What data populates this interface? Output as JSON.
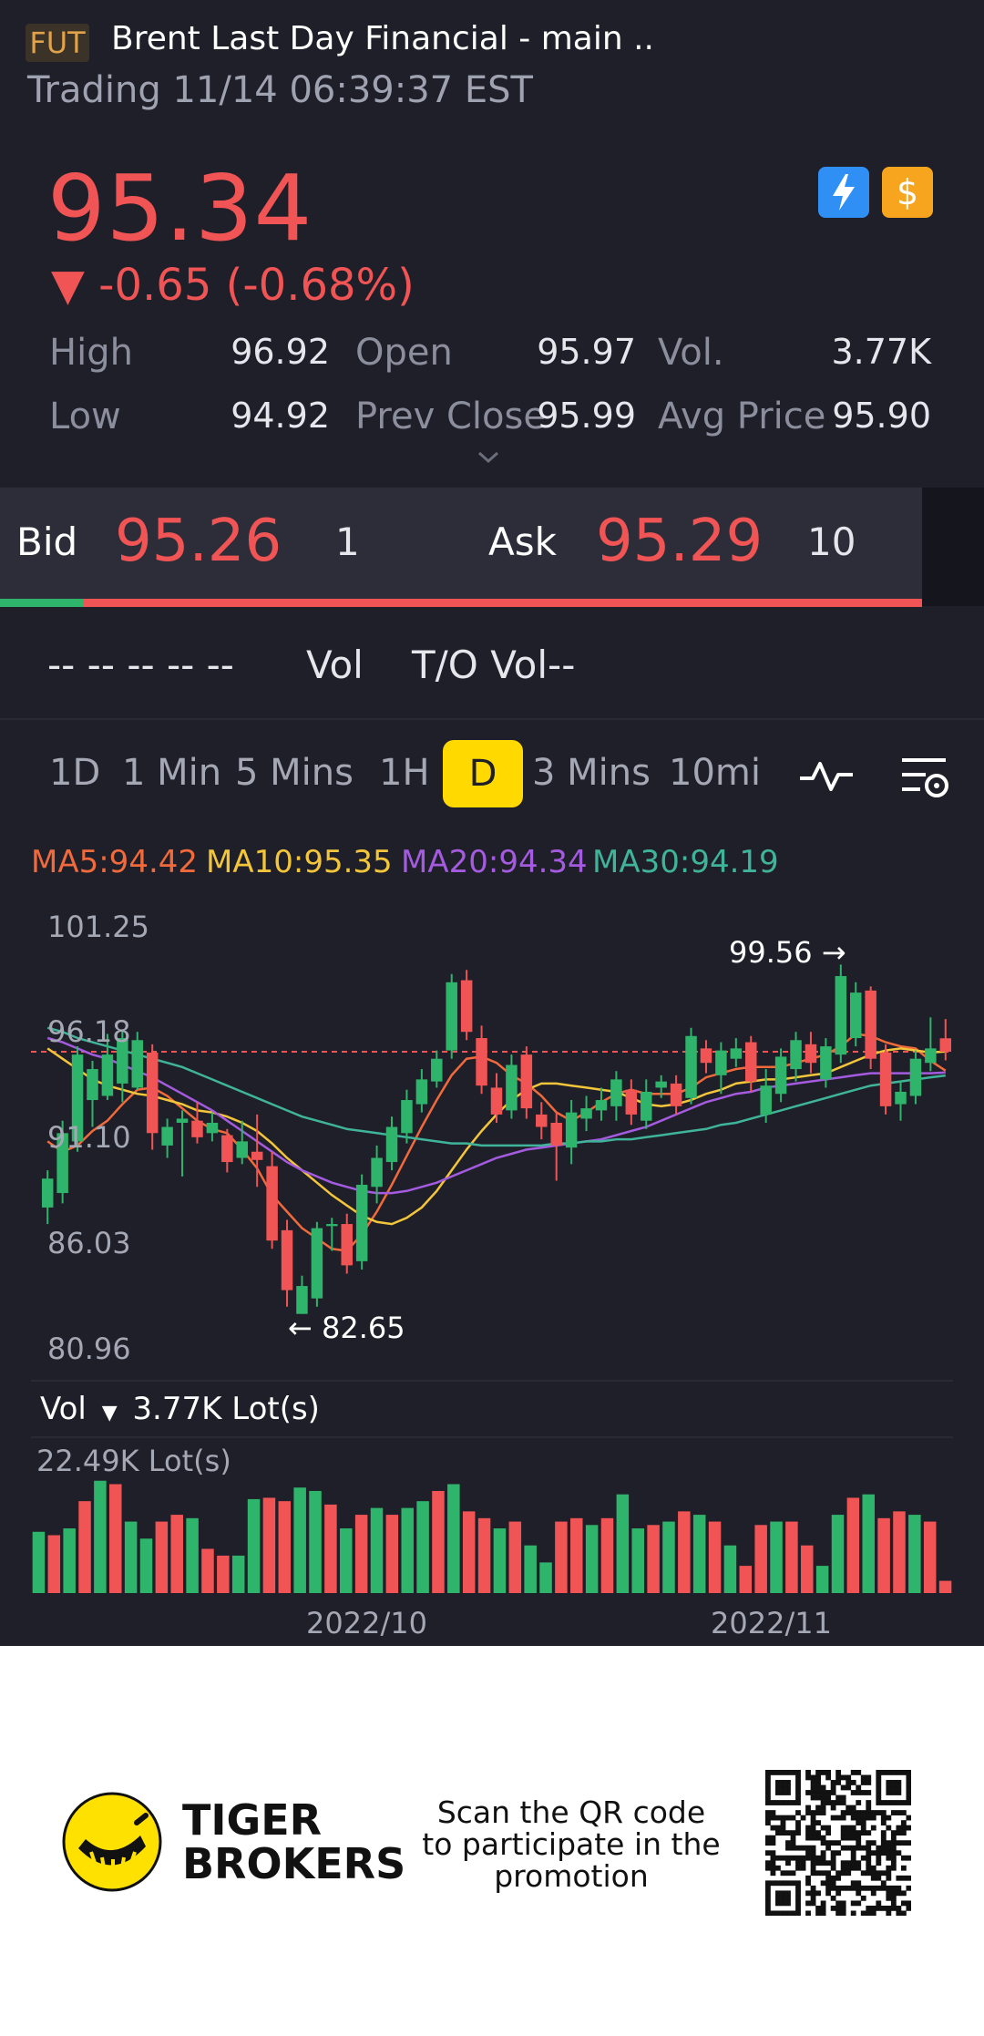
{
  "header": {
    "badge": "FUT",
    "title": "Brent Last Day Financial - main ..",
    "status": "Trading 11/14 06:39:37 EST"
  },
  "quote": {
    "price": "95.34",
    "change": "▼ -0.65 (-0.68%)",
    "color_down": "#f05454",
    "color_up": "#2fb56b"
  },
  "icons": {
    "bolt": "lightning-icon",
    "dollar": "dollar-icon"
  },
  "stats": {
    "high_label": "High",
    "high": "96.92",
    "low_label": "Low",
    "low": "94.92",
    "open_label": "Open",
    "open": "95.97",
    "prev_close_label": "Prev Close",
    "prev_close": "95.99",
    "vol_label": "Vol.",
    "vol": "3.77K",
    "avg_label": "Avg Price",
    "avg": "95.90"
  },
  "orderbook": {
    "bid_label": "Bid",
    "bid": "95.26",
    "bid_size": "1",
    "ask_label": "Ask",
    "ask": "95.29",
    "ask_size": "10",
    "bid_ratio": 0.09
  },
  "volume_row": {
    "dashes": "-- -- -- -- --",
    "vol": "Vol",
    "to_vol": "T/O Vol--"
  },
  "tabs": [
    "1D",
    "1 Min",
    "5 Mins",
    "1H",
    "D",
    "3 Mins",
    "10mi"
  ],
  "active_tab": "D",
  "ma": {
    "ma5": "MA5:94.42",
    "ma10": "MA10:95.35",
    "ma20": "MA20:94.34",
    "ma30": "MA30:94.19"
  },
  "chart_data": {
    "type": "candlestick",
    "y_ticks": [
      "101.25",
      "96.18",
      "91.10",
      "86.03",
      "80.96"
    ],
    "ylim": [
      80.96,
      101.25
    ],
    "high_marker": "99.56 →",
    "low_marker": "← 82.65",
    "last_price_line": 95.34,
    "candles": [
      {
        "o": 87.8,
        "c": 89.2,
        "h": 89.6,
        "l": 87.0
      },
      {
        "o": 88.5,
        "c": 91.4,
        "h": 92.0,
        "l": 88.0
      },
      {
        "o": 91.0,
        "c": 95.2,
        "h": 95.6,
        "l": 90.5
      },
      {
        "o": 93.0,
        "c": 94.5,
        "h": 94.9,
        "l": 91.7
      },
      {
        "o": 93.2,
        "c": 95.2,
        "h": 96.2,
        "l": 93.0
      },
      {
        "o": 93.8,
        "c": 96.0,
        "h": 96.4,
        "l": 92.9
      },
      {
        "o": 93.6,
        "c": 95.9,
        "h": 96.3,
        "l": 93.5
      },
      {
        "o": 95.3,
        "c": 91.4,
        "h": 95.7,
        "l": 90.6
      },
      {
        "o": 90.8,
        "c": 91.7,
        "h": 92.1,
        "l": 90.2
      },
      {
        "o": 91.9,
        "c": 92.1,
        "h": 92.5,
        "l": 89.3
      },
      {
        "o": 92.0,
        "c": 91.2,
        "h": 92.9,
        "l": 90.9
      },
      {
        "o": 91.4,
        "c": 91.9,
        "h": 92.4,
        "l": 91.0
      },
      {
        "o": 91.3,
        "c": 90.0,
        "h": 91.6,
        "l": 89.5
      },
      {
        "o": 90.2,
        "c": 91.0,
        "h": 92.0,
        "l": 89.9
      },
      {
        "o": 90.5,
        "c": 90.1,
        "h": 92.3,
        "l": 88.8
      },
      {
        "o": 89.8,
        "c": 86.2,
        "h": 90.5,
        "l": 85.8
      },
      {
        "o": 86.7,
        "c": 83.8,
        "h": 87.2,
        "l": 83.0
      },
      {
        "o": 82.65,
        "c": 84.0,
        "h": 84.5,
        "l": 82.65
      },
      {
        "o": 83.4,
        "c": 86.8,
        "h": 87.1,
        "l": 83.0
      },
      {
        "o": 86.9,
        "c": 87.0,
        "h": 87.3,
        "l": 85.7
      },
      {
        "o": 87.0,
        "c": 85.0,
        "h": 87.5,
        "l": 84.6
      },
      {
        "o": 85.2,
        "c": 88.9,
        "h": 89.4,
        "l": 84.8
      },
      {
        "o": 88.8,
        "c": 90.2,
        "h": 90.8,
        "l": 88.0
      },
      {
        "o": 90.0,
        "c": 91.7,
        "h": 92.2,
        "l": 89.6
      },
      {
        "o": 91.4,
        "c": 93.0,
        "h": 93.5,
        "l": 90.9
      },
      {
        "o": 92.8,
        "c": 94.0,
        "h": 94.5,
        "l": 92.4
      },
      {
        "o": 93.9,
        "c": 95.0,
        "h": 95.4,
        "l": 93.6
      },
      {
        "o": 95.4,
        "c": 98.7,
        "h": 99.1,
        "l": 95.0
      },
      {
        "o": 98.8,
        "c": 96.3,
        "h": 99.3,
        "l": 95.9
      },
      {
        "o": 96.0,
        "c": 93.7,
        "h": 96.6,
        "l": 93.3
      },
      {
        "o": 93.6,
        "c": 92.3,
        "h": 94.3,
        "l": 91.9
      },
      {
        "o": 92.5,
        "c": 94.7,
        "h": 95.2,
        "l": 92.1
      },
      {
        "o": 95.2,
        "c": 92.6,
        "h": 95.6,
        "l": 92.1
      },
      {
        "o": 92.3,
        "c": 91.7,
        "h": 92.9,
        "l": 91.1
      },
      {
        "o": 91.9,
        "c": 90.8,
        "h": 92.4,
        "l": 89.1
      },
      {
        "o": 90.7,
        "c": 92.4,
        "h": 93.0,
        "l": 89.9
      },
      {
        "o": 92.1,
        "c": 92.6,
        "h": 93.2,
        "l": 91.5
      },
      {
        "o": 92.5,
        "c": 93.0,
        "h": 93.6,
        "l": 92.0
      },
      {
        "o": 92.7,
        "c": 94.0,
        "h": 94.4,
        "l": 92.0
      },
      {
        "o": 93.5,
        "c": 92.3,
        "h": 94.0,
        "l": 91.8
      },
      {
        "o": 92.0,
        "c": 93.4,
        "h": 94.0,
        "l": 91.6
      },
      {
        "o": 93.6,
        "c": 93.9,
        "h": 94.2,
        "l": 93.1
      },
      {
        "o": 93.8,
        "c": 92.7,
        "h": 94.2,
        "l": 92.3
      },
      {
        "o": 93.1,
        "c": 96.1,
        "h": 96.5,
        "l": 92.8
      },
      {
        "o": 95.5,
        "c": 94.8,
        "h": 95.9,
        "l": 94.3
      },
      {
        "o": 94.2,
        "c": 95.4,
        "h": 95.8,
        "l": 93.3
      },
      {
        "o": 95.0,
        "c": 95.5,
        "h": 96.0,
        "l": 94.6
      },
      {
        "o": 95.8,
        "c": 93.9,
        "h": 96.1,
        "l": 93.4
      },
      {
        "o": 92.3,
        "c": 93.7,
        "h": 94.5,
        "l": 91.9
      },
      {
        "o": 93.3,
        "c": 95.1,
        "h": 95.5,
        "l": 92.9
      },
      {
        "o": 94.5,
        "c": 95.9,
        "h": 96.3,
        "l": 93.9
      },
      {
        "o": 95.7,
        "c": 94.8,
        "h": 96.3,
        "l": 94.3
      },
      {
        "o": 94.0,
        "c": 95.6,
        "h": 96.0,
        "l": 93.6
      },
      {
        "o": 95.2,
        "c": 99.0,
        "h": 99.56,
        "l": 94.8
      },
      {
        "o": 96.0,
        "c": 98.2,
        "h": 98.7,
        "l": 95.6
      },
      {
        "o": 98.3,
        "c": 95.0,
        "h": 98.5,
        "l": 94.5
      },
      {
        "o": 95.3,
        "c": 92.7,
        "h": 95.7,
        "l": 92.3
      },
      {
        "o": 92.8,
        "c": 93.4,
        "h": 93.9,
        "l": 92.0
      },
      {
        "o": 93.2,
        "c": 95.0,
        "h": 95.4,
        "l": 92.8
      },
      {
        "o": 94.8,
        "c": 95.5,
        "h": 97.0,
        "l": 94.4
      },
      {
        "o": 95.99,
        "c": 95.34,
        "h": 96.92,
        "l": 94.92
      }
    ],
    "ma_lines": [
      {
        "name": "MA5",
        "color": "#f06a3c",
        "values": [
          91.0,
          90.5,
          90.8,
          91.5,
          92.0,
          92.8,
          93.5,
          93.6,
          93.2,
          92.6,
          92.0,
          91.6,
          91.4,
          90.6,
          89.7,
          88.4,
          87.6,
          86.8,
          86.3,
          85.8,
          85.7,
          86.5,
          87.6,
          88.9,
          90.3,
          91.7,
          93.0,
          94.2,
          95.0,
          95.1,
          94.8,
          94.2,
          93.8,
          93.2,
          92.4,
          92.0,
          92.4,
          92.9,
          93.3,
          93.5,
          93.3,
          93.3,
          93.3,
          93.6,
          94.1,
          94.3,
          94.5,
          94.6,
          94.6,
          94.6,
          94.8,
          95.0,
          95.2,
          95.6,
          96.2,
          96.1,
          95.8,
          95.6,
          95.5,
          94.9,
          94.42
        ]
      },
      {
        "name": "MA10",
        "color": "#f2c53a",
        "values": [
          95.5,
          95.0,
          94.5,
          94.0,
          93.7,
          93.5,
          93.3,
          93.2,
          93.0,
          92.8,
          92.5,
          92.4,
          92.2,
          91.9,
          91.5,
          90.9,
          90.2,
          89.6,
          89.0,
          88.4,
          87.9,
          87.4,
          87.1,
          87.0,
          87.3,
          87.8,
          88.6,
          89.6,
          90.6,
          91.5,
          92.3,
          93.0,
          93.5,
          93.8,
          93.8,
          93.7,
          93.6,
          93.5,
          93.4,
          93.1,
          92.8,
          92.7,
          92.8,
          93.0,
          93.3,
          93.5,
          93.8,
          93.9,
          94.0,
          94.0,
          94.1,
          94.2,
          94.3,
          94.6,
          94.9,
          95.2,
          95.4,
          95.5,
          95.4,
          95.3,
          95.35
        ]
      },
      {
        "name": "MA20",
        "color": "#a45be0",
        "values": [
          96.0,
          95.8,
          95.5,
          95.2,
          95.0,
          94.7,
          94.4,
          94.1,
          93.7,
          93.3,
          92.9,
          92.5,
          92.0,
          91.5,
          91.0,
          90.5,
          90.0,
          89.6,
          89.3,
          89.0,
          88.8,
          88.6,
          88.5,
          88.5,
          88.6,
          88.8,
          89.0,
          89.3,
          89.6,
          89.9,
          90.2,
          90.4,
          90.6,
          90.7,
          90.8,
          90.9,
          91.0,
          91.1,
          91.3,
          91.5,
          91.7,
          92.0,
          92.3,
          92.6,
          92.9,
          93.1,
          93.3,
          93.4,
          93.6,
          93.7,
          93.8,
          93.9,
          94.0,
          94.1,
          94.2,
          94.3,
          94.3,
          94.3,
          94.3,
          94.3,
          94.34
        ]
      },
      {
        "name": "MA30",
        "color": "#3fb49a",
        "values": [
          96.5,
          96.3,
          96.0,
          95.8,
          95.6,
          95.4,
          95.2,
          95.0,
          94.8,
          94.6,
          94.3,
          94.0,
          93.7,
          93.4,
          93.1,
          92.8,
          92.5,
          92.2,
          92.0,
          91.8,
          91.6,
          91.5,
          91.4,
          91.3,
          91.2,
          91.1,
          91.0,
          90.9,
          90.9,
          90.8,
          90.8,
          90.8,
          90.8,
          90.8,
          90.9,
          90.9,
          91.0,
          91.0,
          91.1,
          91.1,
          91.2,
          91.3,
          91.4,
          91.5,
          91.6,
          91.8,
          91.9,
          92.1,
          92.3,
          92.5,
          92.7,
          92.9,
          93.1,
          93.3,
          93.5,
          93.7,
          93.8,
          93.9,
          94.0,
          94.1,
          94.19
        ]
      }
    ],
    "x_labels": [
      "2022/10",
      "2022/11"
    ]
  },
  "volume_panel": {
    "header": "Vol",
    "current": "3.77K Lot(s)",
    "max_label": "22.49K Lot(s)",
    "max": 22.49,
    "values": [
      9.0,
      8.5,
      9.5,
      13.5,
      16.5,
      16.0,
      10.5,
      8.0,
      10.5,
      11.5,
      11.0,
      6.5,
      5.5,
      5.5,
      13.8,
      14.0,
      13.5,
      15.5,
      15.0,
      13.0,
      9.5,
      11.5,
      12.5,
      11.5,
      12.5,
      13.5,
      15.0,
      16.0,
      12.0,
      11.0,
      9.5,
      10.5,
      7.0,
      4.5,
      10.5,
      11.0,
      10.0,
      11.0,
      14.5,
      9.5,
      10.0,
      10.5,
      12.0,
      11.5,
      10.5,
      7.0,
      4.0,
      10.0,
      10.5,
      10.5,
      7.0,
      4.0,
      11.5,
      14.0,
      14.5,
      11.0,
      12.0,
      11.5,
      10.5,
      1.8
    ],
    "colors": [
      "g",
      "r",
      "g",
      "r",
      "g",
      "r",
      "g",
      "g",
      "r",
      "r",
      "g",
      "r",
      "r",
      "g",
      "g",
      "r",
      "r",
      "g",
      "g",
      "r",
      "g",
      "r",
      "g",
      "r",
      "g",
      "g",
      "r",
      "g",
      "r",
      "r",
      "g",
      "r",
      "g",
      "g",
      "r",
      "r",
      "g",
      "r",
      "g",
      "g",
      "r",
      "g",
      "r",
      "g",
      "r",
      "g",
      "r",
      "r",
      "g",
      "r",
      "r",
      "g",
      "g",
      "r",
      "g",
      "r",
      "r",
      "g",
      "r",
      "r"
    ]
  },
  "footer": {
    "brand_line1": "TIGER",
    "brand_line2": "BROKERS",
    "scan_text": "Scan the QR code to participate in the promotion"
  }
}
